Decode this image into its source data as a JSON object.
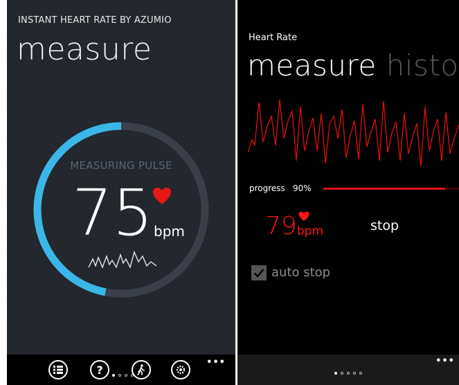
{
  "left_screen": {
    "app_title": "INSTANT HEART RATE BY AZUMIO",
    "page_title": "measure",
    "status_text": "MEASURING PULSE",
    "bpm_value": "75",
    "bpm_unit": "bpm",
    "gauge_progress": 0.47,
    "colors": {
      "gauge_fill": "#3ab7e8",
      "gauge_track": "#3a3f4a",
      "heart": "#e81818"
    },
    "appbar": {
      "buttons": [
        {
          "name": "list-button",
          "icon": "list-icon"
        },
        {
          "name": "help-button",
          "icon": "question-icon"
        },
        {
          "name": "walk-button",
          "icon": "walking-person-icon"
        },
        {
          "name": "settings-button",
          "icon": "gear-icon"
        }
      ],
      "more": "•••"
    },
    "page_dots": 4,
    "active_dot": 0
  },
  "right_screen": {
    "app_title": "Heart Rate",
    "pivot_tabs": [
      {
        "label": "measure",
        "active": true
      },
      {
        "label": "history",
        "active": false
      }
    ],
    "progress_label": "progress",
    "progress_percent_text": "90%",
    "progress_value": 0.9,
    "bpm_value": "79",
    "bpm_unit": "bpm",
    "stop_label": "stop",
    "auto_stop": {
      "label": "auto stop",
      "checked": true
    },
    "colors": {
      "graph_line": "#e01010",
      "accent_red": "#ff1414"
    },
    "appbar": {
      "more": "•••"
    },
    "page_dots": 5,
    "active_dot": 0
  }
}
